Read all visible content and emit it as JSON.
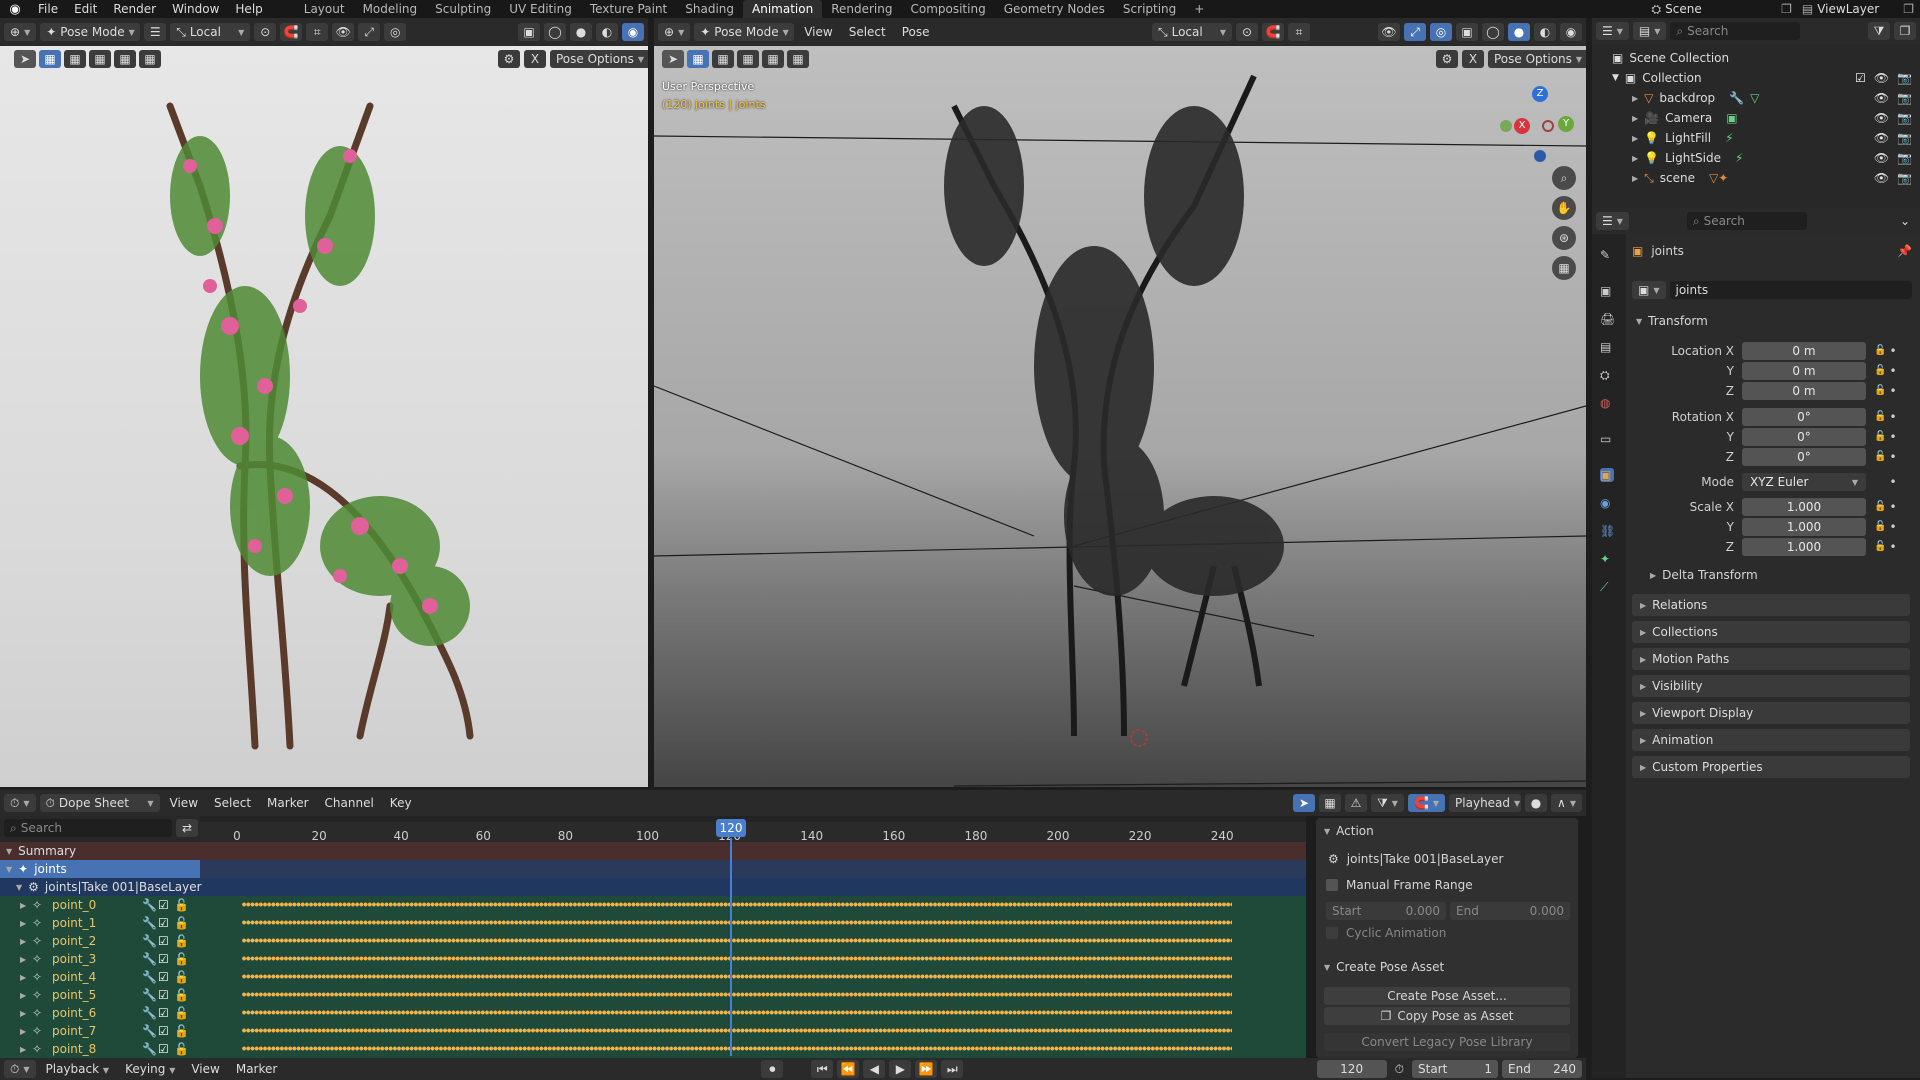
{
  "topbar": {
    "menus": [
      "File",
      "Edit",
      "Render",
      "Window",
      "Help"
    ],
    "workspaces": [
      "Layout",
      "Modeling",
      "Sculpting",
      "UV Editing",
      "Texture Paint",
      "Shading",
      "Animation",
      "Rendering",
      "Compositing",
      "Geometry Nodes",
      "Scripting"
    ],
    "active_workspace": "Animation",
    "add_tab": "+",
    "scene": "Scene",
    "view_layer": "ViewLayer"
  },
  "left_view": {
    "mode": "Pose Mode",
    "orientation": "Local",
    "pose_options": "Pose Options"
  },
  "right_view": {
    "mode": "Pose Mode",
    "menus": [
      "View",
      "Select",
      "Pose"
    ],
    "orientation": "Local",
    "pose_options": "Pose Options",
    "overlay_line1": "User Perspective",
    "overlay_line2": "(120) joints | joints",
    "gizmo": {
      "z": "Z",
      "x": "X",
      "y": "Y"
    }
  },
  "outliner": {
    "search_placeholder": "Search",
    "root": "Scene Collection",
    "collection": "Collection",
    "items": [
      "backdrop",
      "Camera",
      "LightFill",
      "LightSide",
      "scene"
    ]
  },
  "properties": {
    "search_placeholder": "Search",
    "object_name": "joints",
    "datablock": "joints",
    "transform_title": "Transform",
    "location": {
      "label": "Location X",
      "x": "0 m",
      "y": "0 m",
      "z": "0 m"
    },
    "rotation": {
      "label": "Rotation X",
      "x": "0°",
      "y": "0°",
      "z": "0°"
    },
    "axis_y": "Y",
    "axis_z": "Z",
    "mode_label": "Mode",
    "mode_value": "XYZ Euler",
    "scale": {
      "label": "Scale X",
      "x": "1.000",
      "y": "1.000",
      "z": "1.000"
    },
    "delta_transform": "Delta Transform",
    "sections": [
      "Relations",
      "Collections",
      "Motion Paths",
      "Visibility",
      "Viewport Display",
      "Animation",
      "Custom Properties"
    ]
  },
  "dopesheet": {
    "editor": "Dope Sheet",
    "menus": [
      "View",
      "Select",
      "Marker",
      "Channel",
      "Key"
    ],
    "playhead_label": "Playhead",
    "search_placeholder": "Search",
    "ticks": [
      "0",
      "20",
      "40",
      "60",
      "80",
      "100",
      "120",
      "140",
      "160",
      "180",
      "200",
      "220",
      "240"
    ],
    "current_frame": "120",
    "summary": "Summary",
    "object": "joints",
    "action": "joints|Take 001|BaseLayer",
    "channels": [
      "point_0",
      "point_1",
      "point_2",
      "point_3",
      "point_4",
      "point_5",
      "point_6",
      "point_7",
      "point_8"
    ]
  },
  "action_panel": {
    "title": "Action",
    "action_name": "joints|Take 001|BaseLayer",
    "manual_range": "Manual Frame Range",
    "start_label": "Start",
    "start_value": "0.000",
    "end_label": "End",
    "end_value": "0.000",
    "cyclic": "Cyclic Animation",
    "pose_title": "Create Pose Asset",
    "create_pose": "Create Pose Asset...",
    "copy_pose": "Copy Pose as Asset",
    "convert_legacy": "Convert Legacy Pose Library"
  },
  "timeline": {
    "menus": [
      "Playback",
      "Keying",
      "View",
      "Marker"
    ],
    "frame": "120",
    "start_label": "Start",
    "start_value": "1",
    "end_label": "End",
    "end_value": "240"
  },
  "colors": {
    "accent": "#4772b3",
    "keyframe": "#f2b24a",
    "playhead": "#4a7fd0",
    "channel_bg": "#1f4a3a"
  }
}
